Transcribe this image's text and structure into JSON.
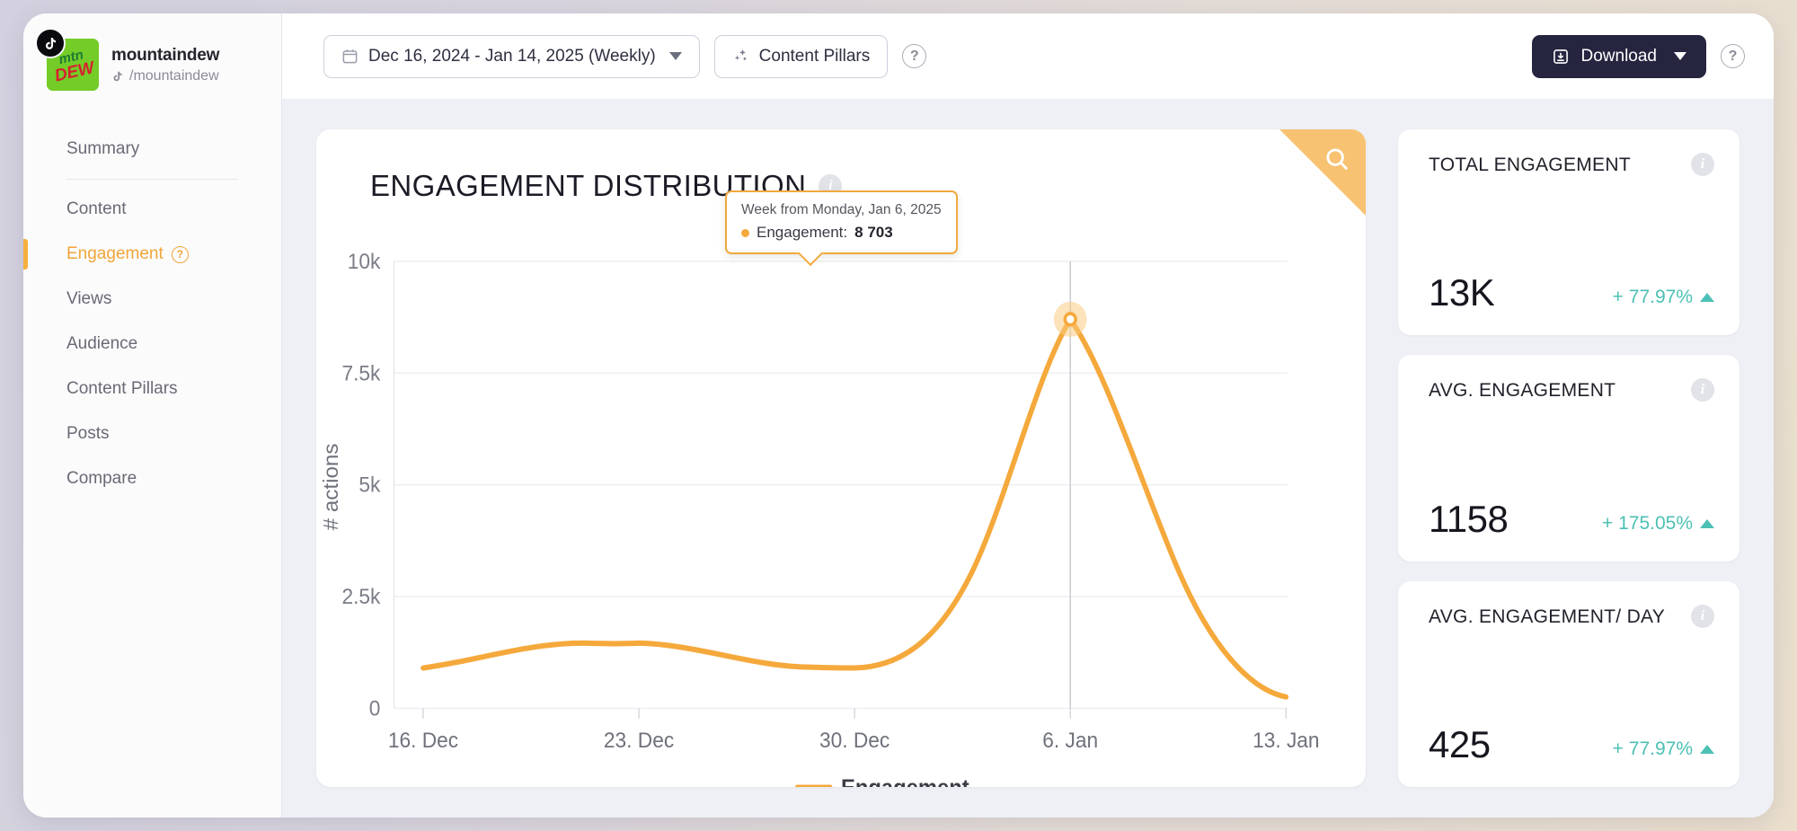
{
  "sidebar": {
    "brand": {
      "name": "mountaindew",
      "handle": "/mountaindew",
      "platform_icon": "tiktok-icon"
    },
    "items": [
      {
        "label": "Summary",
        "active": false
      },
      {
        "label": "Content",
        "active": false
      },
      {
        "label": "Engagement",
        "active": true,
        "help": "?"
      },
      {
        "label": "Views",
        "active": false
      },
      {
        "label": "Audience",
        "active": false
      },
      {
        "label": "Content Pillars",
        "active": false
      },
      {
        "label": "Posts",
        "active": false
      },
      {
        "label": "Compare",
        "active": false
      }
    ]
  },
  "toolbar": {
    "date_range": "Dec 16, 2024 - Jan 14, 2025 (Weekly)",
    "date_icon": "calendar-icon",
    "content_pillars": "Content Pillars",
    "content_pillars_icon": "sparkle-icon",
    "help": "?",
    "download": "Download",
    "download_icon": "download-icon",
    "download_help": "?"
  },
  "chart_card": {
    "title": "ENGAGEMENT DISTRIBUTION",
    "info": "i",
    "search_icon": "search-icon",
    "tooltip": {
      "title": "Week from Monday, Jan 6, 2025",
      "series": "Engagement:",
      "value": "8 703"
    }
  },
  "chart_data": {
    "type": "line",
    "title": "ENGAGEMENT DISTRIBUTION",
    "xlabel": "",
    "ylabel": "# actions",
    "categories": [
      "16. Dec",
      "23. Dec",
      "30. Dec",
      "6. Jan",
      "13. Jan"
    ],
    "x_tick_labels": [
      "16. Dec",
      "23. Dec",
      "30. Dec",
      "6. Jan",
      "13. Jan"
    ],
    "y_tick_labels": [
      "0",
      "2.5k",
      "5k",
      "7.5k",
      "10k"
    ],
    "y_ticks": [
      0,
      2500,
      5000,
      7500,
      10000
    ],
    "ylim": [
      0,
      10000
    ],
    "grid": true,
    "legend": "bottom",
    "series": [
      {
        "name": "Engagement",
        "color": "#f5a93c",
        "values": [
          900,
          1450,
          950,
          8703,
          380
        ]
      }
    ],
    "highlight": {
      "category": "6. Jan",
      "value": 8703,
      "label": "Week from Monday, Jan 6, 2025"
    },
    "legend_entries": [
      "Engagement"
    ]
  },
  "kpi_cards": [
    {
      "label": "TOTAL ENGAGEMENT",
      "value": "13K",
      "delta": "+ 77.97%",
      "direction": "up",
      "info": "i"
    },
    {
      "label": "AVG. ENGAGEMENT",
      "value": "1158",
      "delta": "+ 175.05%",
      "direction": "up",
      "info": "i"
    },
    {
      "label": "AVG. ENGAGEMENT/ DAY",
      "value": "425",
      "delta": "+ 77.97%",
      "direction": "up",
      "info": "i"
    }
  ],
  "colors": {
    "accent_orange": "#f5a93c",
    "delta_teal": "#4cc0b4",
    "download_navy": "#252540",
    "canvas": "#eef0f5"
  }
}
